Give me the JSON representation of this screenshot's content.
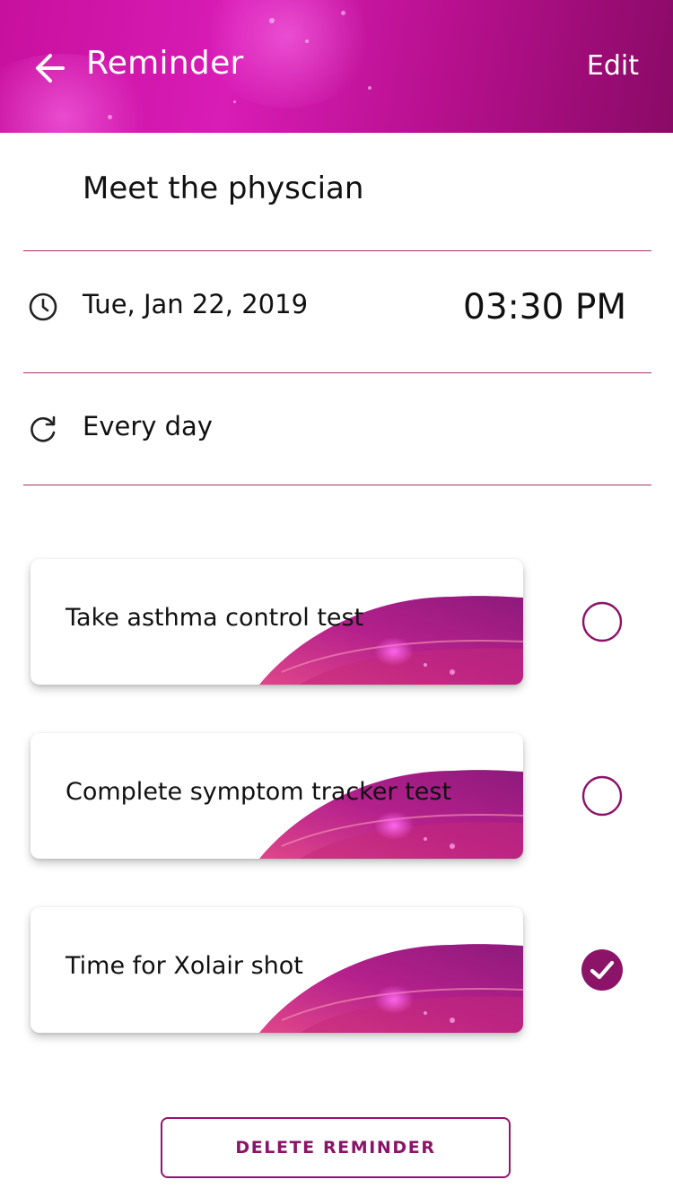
{
  "header": {
    "title": "Reminder",
    "edit_label": "Edit",
    "back_icon": "arrow-left-icon"
  },
  "reminder": {
    "name": "Meet the physcian",
    "date": "Tue, Jan 22, 2019",
    "time": "03:30 PM",
    "repeat": "Every day",
    "date_icon": "clock-icon",
    "repeat_icon": "refresh-icon"
  },
  "tasks": [
    {
      "label": "Take asthma control test",
      "checked": false
    },
    {
      "label": "Complete symptom tracker test",
      "checked": false
    },
    {
      "label": "Time for Xolair shot",
      "checked": true
    }
  ],
  "delete_label": "DELETE REMINDER",
  "colors": {
    "brand": "#c8109e",
    "brand_dark": "#8a0a66",
    "divider": "#a3336f",
    "check": "#8c1468"
  }
}
